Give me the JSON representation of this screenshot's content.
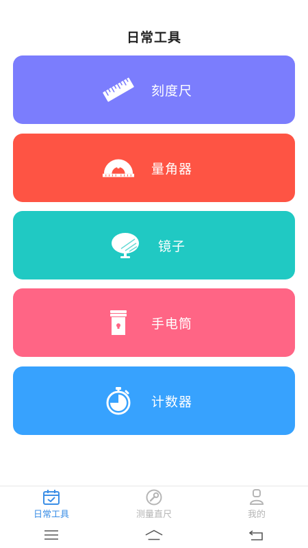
{
  "page": {
    "title": "日常工具"
  },
  "tools": [
    {
      "label": "刻度尺",
      "icon": "ruler-icon",
      "color": "#7b7dfd"
    },
    {
      "label": "量角器",
      "icon": "protractor-icon",
      "color": "#fe5444"
    },
    {
      "label": "镜子",
      "icon": "mirror-icon",
      "color": "#20c9c3"
    },
    {
      "label": "手电筒",
      "icon": "flashlight-icon",
      "color": "#ff6585"
    },
    {
      "label": "计数器",
      "icon": "stopwatch-icon",
      "color": "#37a2fe"
    }
  ],
  "tabbar": {
    "items": [
      {
        "label": "日常工具",
        "icon": "calendar-check-icon",
        "active": true
      },
      {
        "label": "测量直尺",
        "icon": "wrench-circle-icon",
        "active": false
      },
      {
        "label": "我的",
        "icon": "person-icon",
        "active": false
      }
    ],
    "active_color": "#3a8ee6",
    "inactive_color": "#b5b5b5"
  },
  "system_nav": [
    "menu-icon",
    "home-icon",
    "back-icon"
  ]
}
